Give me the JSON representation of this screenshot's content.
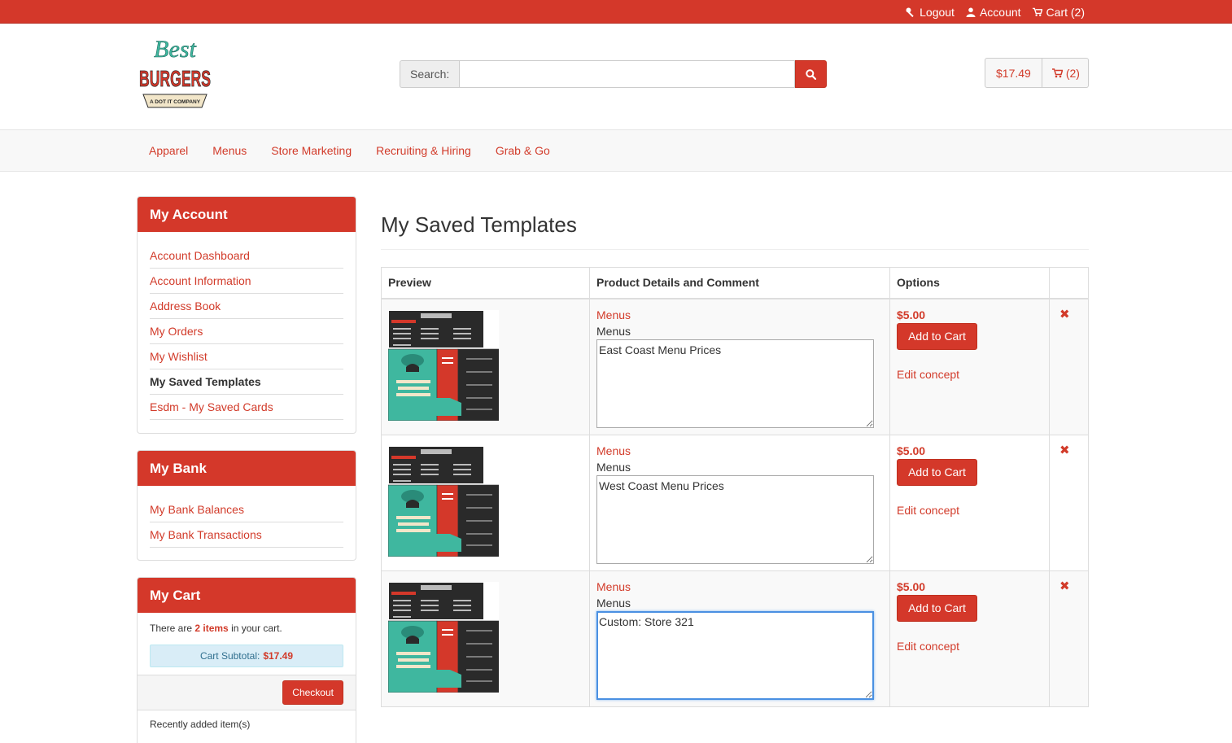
{
  "topbar": {
    "logout": "Logout",
    "account": "Account",
    "cart": "Cart (2)"
  },
  "header": {
    "logo_alt": "Best Burgers - A Dot It Company",
    "logo_text_top": "Best",
    "logo_text_main": "BURGERS",
    "logo_text_sub": "A DOT IT COMPANY",
    "search_label": "Search:",
    "search_value": "",
    "cart_total": "$17.49",
    "cart_count": "(2)"
  },
  "nav": [
    "Apparel",
    "Menus",
    "Store Marketing",
    "Recruiting & Hiring",
    "Grab & Go"
  ],
  "sidebar": {
    "account": {
      "title": "My Account",
      "items": [
        "Account Dashboard",
        "Account Information",
        "Address Book",
        "My Orders",
        "My Wishlist",
        "My Saved Templates",
        "Esdm - My Saved Cards"
      ],
      "active": "My Saved Templates"
    },
    "bank": {
      "title": "My Bank",
      "items": [
        "My Bank Balances",
        "My Bank Transactions"
      ]
    },
    "cart": {
      "title": "My Cart",
      "text_before": "There are",
      "items_link": "2 items",
      "text_after": "in your cart.",
      "subtotal_label": "Cart Subtotal:",
      "subtotal_value": "$17.49",
      "checkout": "Checkout",
      "recent": "Recently added item(s)"
    }
  },
  "main": {
    "title": "My Saved Templates",
    "columns": [
      "Preview",
      "Product Details and Comment",
      "Options",
      ""
    ],
    "rows": [
      {
        "product": "Menus",
        "category": "Menus",
        "comment": "East Coast Menu Prices",
        "price": "$5.00",
        "add": "Add to Cart",
        "edit": "Edit concept",
        "delete": "✖"
      },
      {
        "product": "Menus",
        "category": "Menus",
        "comment": "West Coast Menu Prices",
        "price": "$5.00",
        "add": "Add to Cart",
        "edit": "Edit concept",
        "delete": "✖"
      },
      {
        "product": "Menus",
        "category": "Menus",
        "comment": "Custom: Store 321",
        "price": "$5.00",
        "add": "Add to Cart",
        "edit": "Edit concept",
        "delete": "✖"
      }
    ]
  },
  "colors": {
    "brand": "#d4382a",
    "link": "#d23b2a",
    "teal": "#3fb79f",
    "dark": "#2a2a2a"
  }
}
